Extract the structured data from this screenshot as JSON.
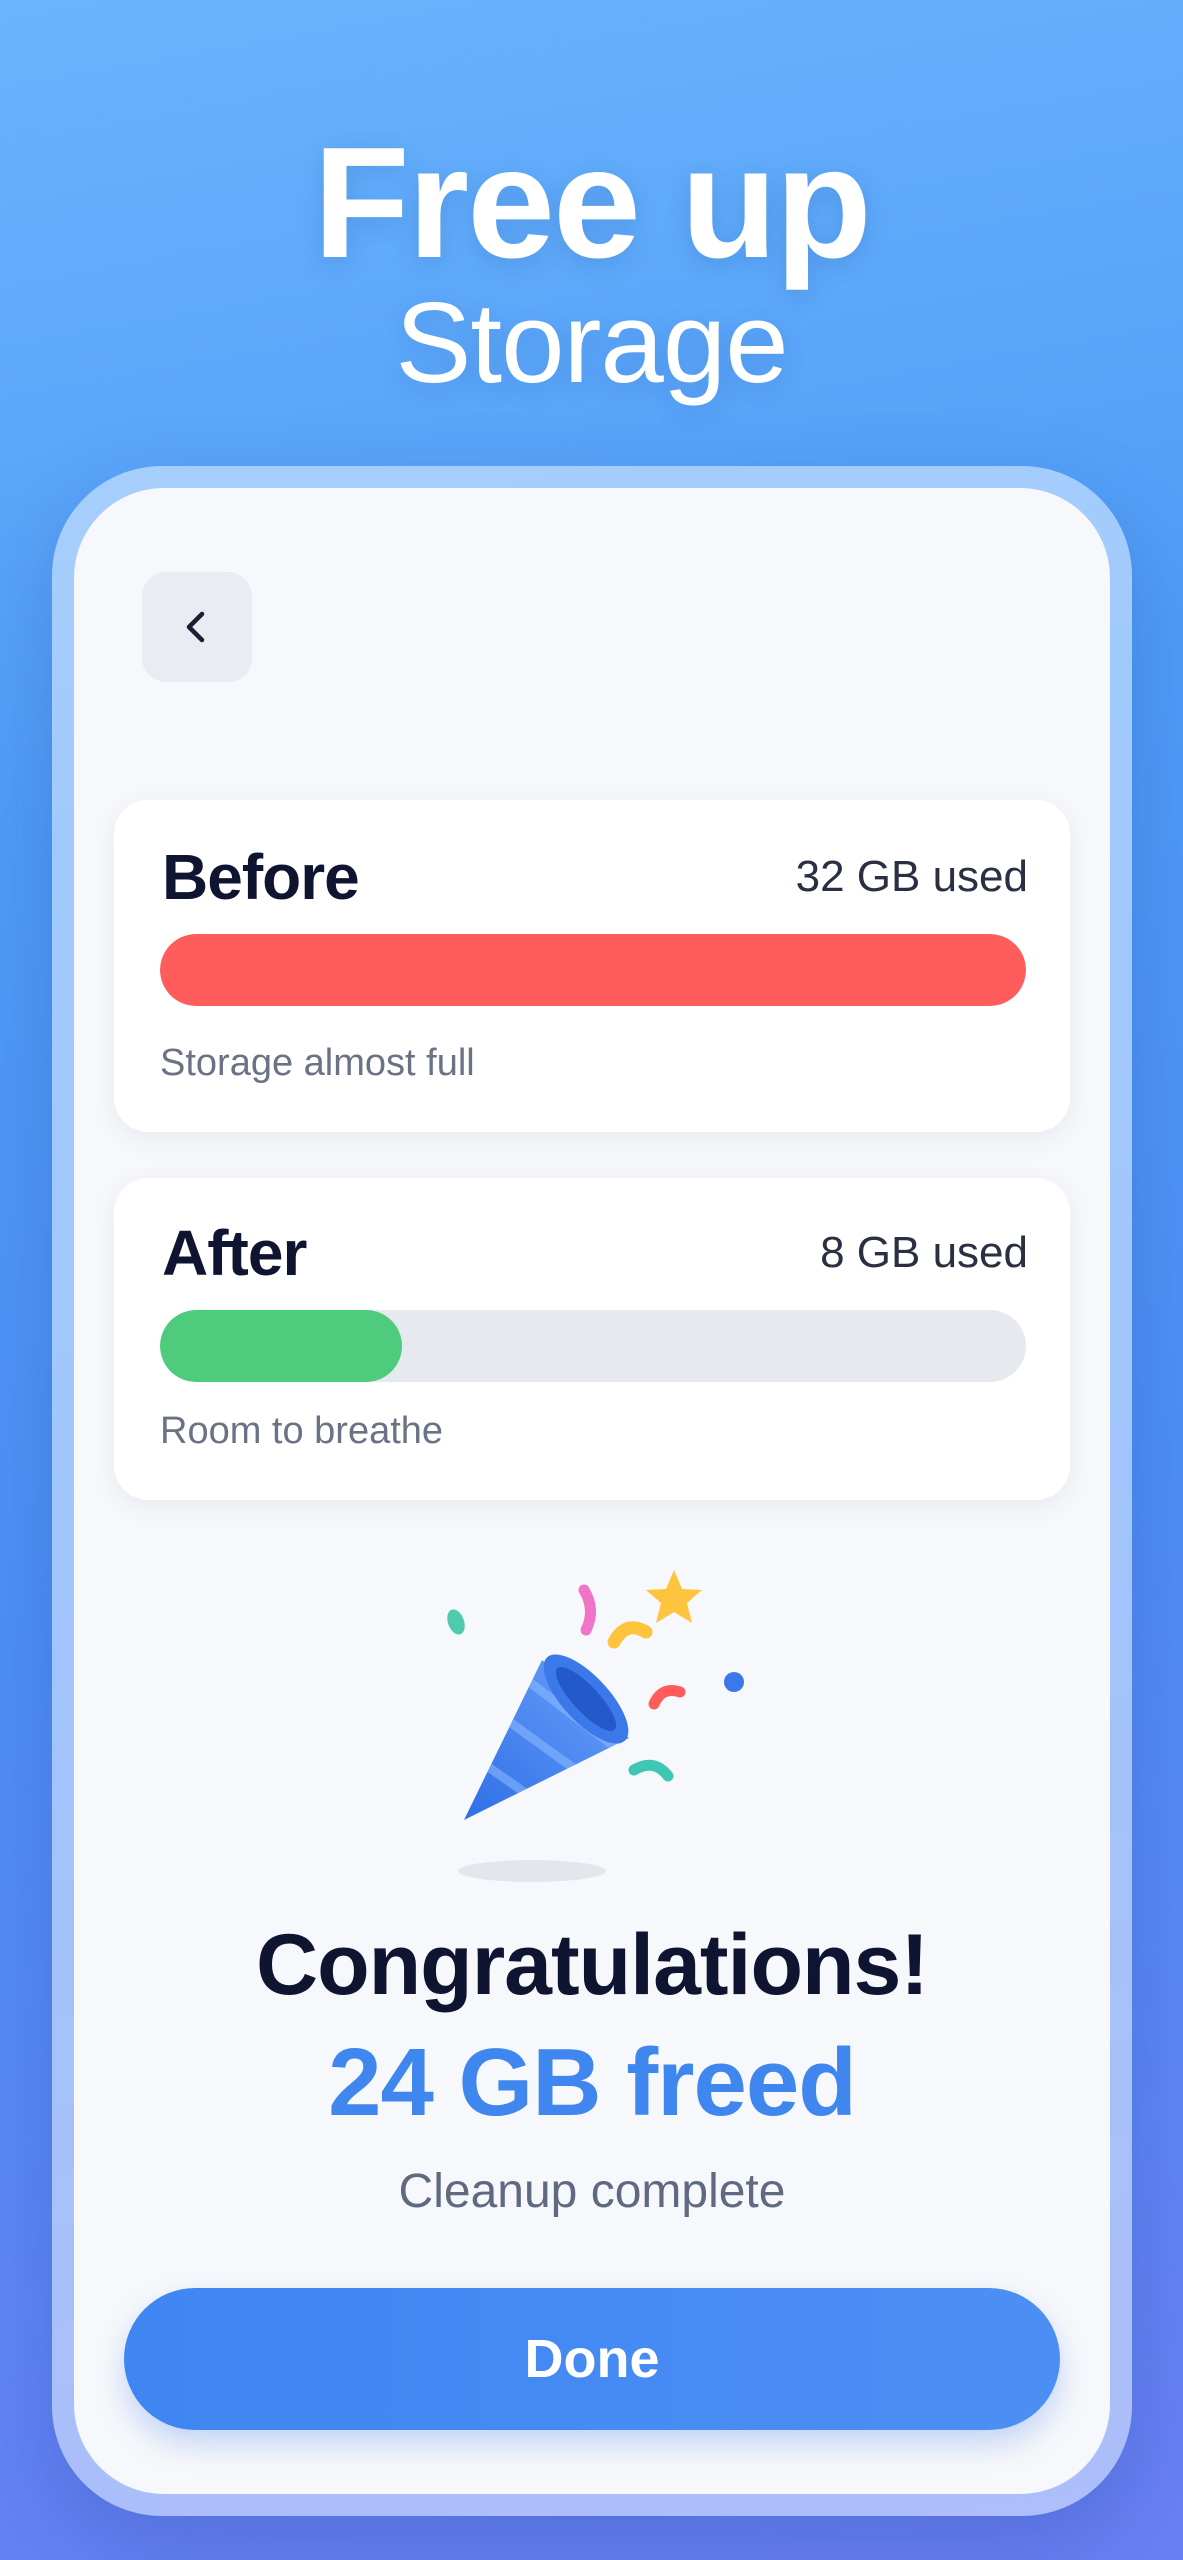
{
  "promo": {
    "title_line1": "Free up",
    "title_line2": "Storage"
  },
  "header": {
    "back_icon": "chevron-left-icon"
  },
  "storage": {
    "before": {
      "label": "Before",
      "usage": "32 GB used",
      "caption": "Storage almost full",
      "fill_percent": 100,
      "color": "#ff5d5b"
    },
    "after": {
      "label": "After",
      "usage": "8 GB used",
      "caption": "Room to breathe",
      "fill_percent": 28,
      "color": "#4ecb7c"
    }
  },
  "result": {
    "icon": "party-popper-icon",
    "title": "Congratulations!",
    "amount": "24 GB freed",
    "subtitle": "Cleanup complete",
    "accent_color": "#3f86ef"
  },
  "actions": {
    "done_label": "Done"
  }
}
